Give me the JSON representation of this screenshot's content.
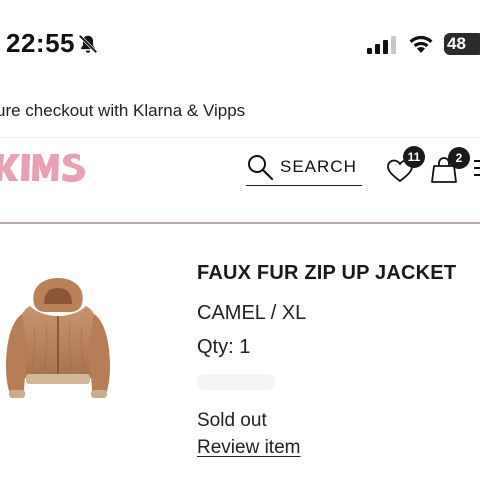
{
  "status_bar": {
    "time": "22:55",
    "battery": "48",
    "icons": [
      "bell-slash-icon",
      "signal-icon",
      "wifi-icon",
      "battery-icon"
    ]
  },
  "promo": {
    "text": "ure checkout with Klarna & Vipps"
  },
  "header": {
    "logo": "KIMS",
    "search_label": "SEARCH",
    "wishlist_count": "11",
    "cart_count": "2",
    "brand_color": "#e8a0b4"
  },
  "product": {
    "name": "FAUX FUR ZIP UP JACKET",
    "variant": "CAMEL / XL",
    "qty": "Qty: 1",
    "status": "Sold out",
    "review_link": "Review item",
    "image_icon": "faux-fur-jacket-image"
  }
}
